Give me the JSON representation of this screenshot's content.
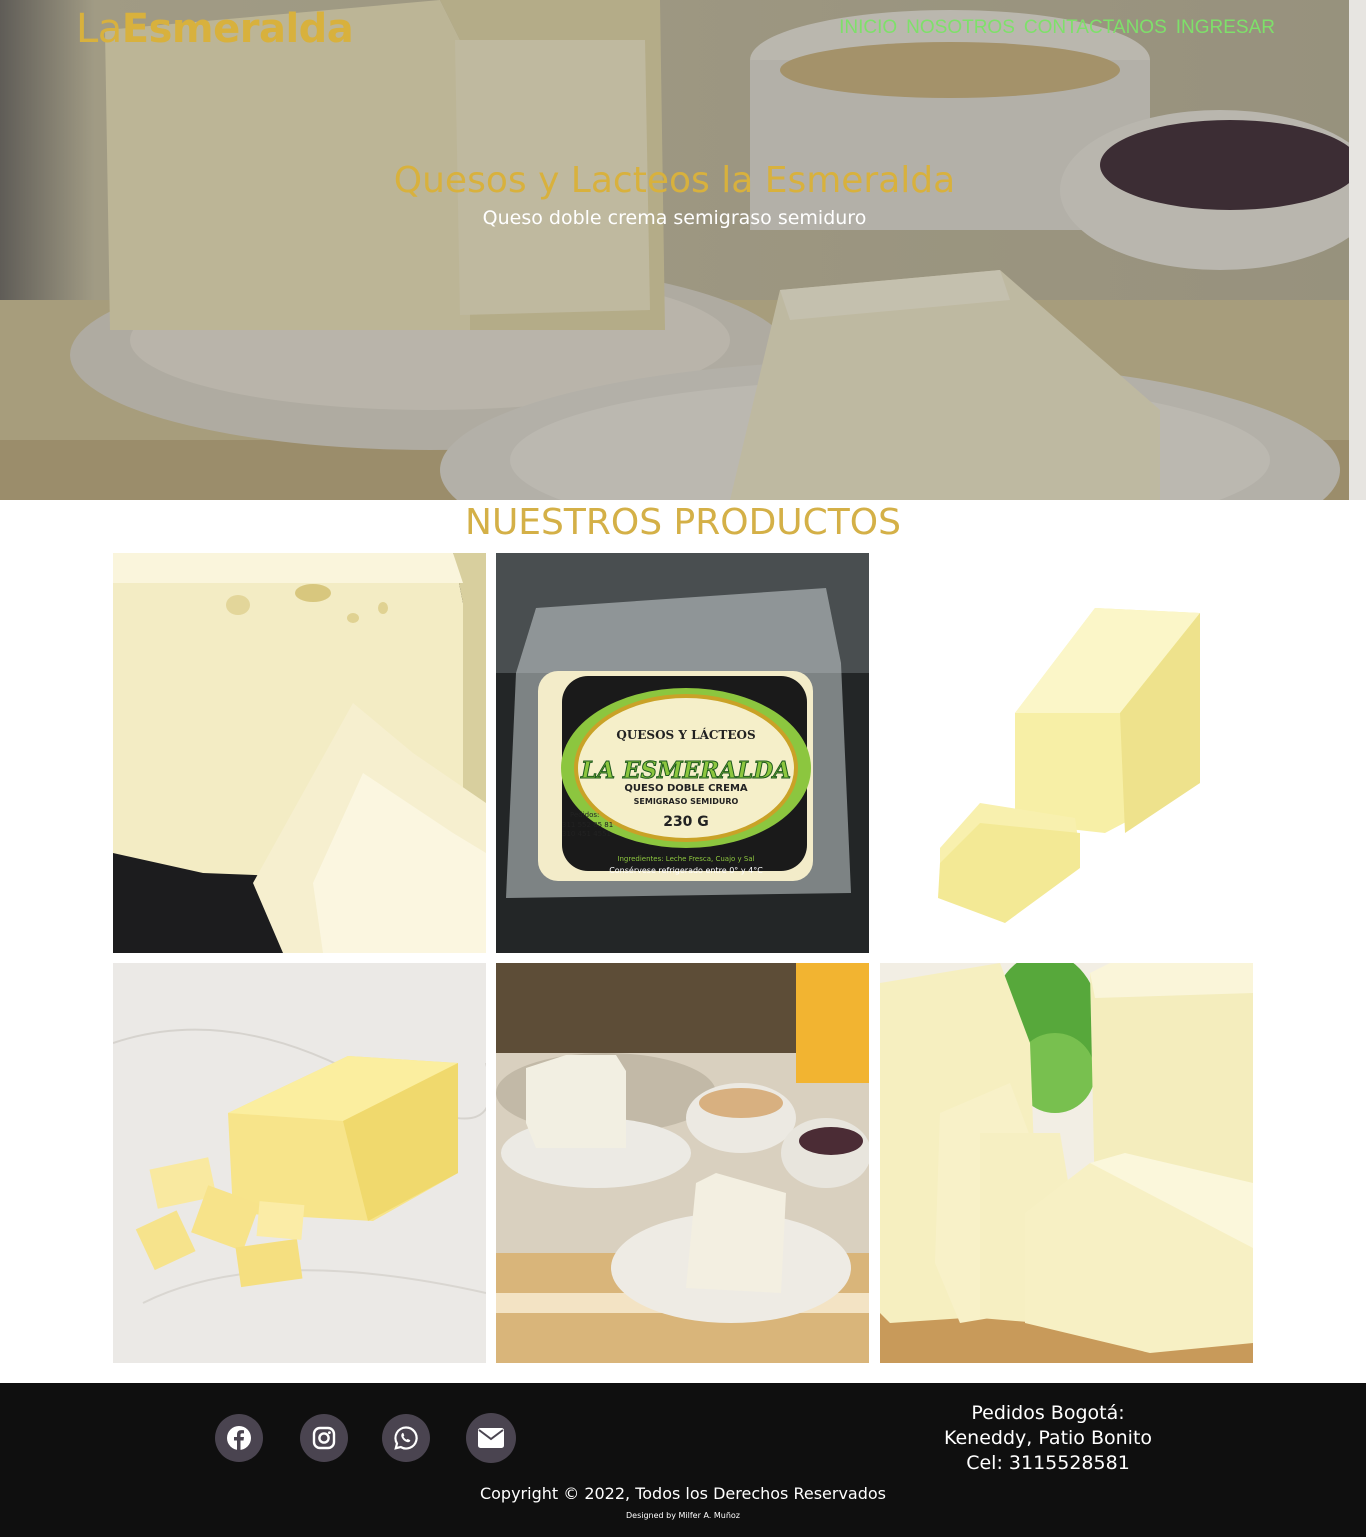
{
  "header": {
    "logo_light": "La",
    "logo_bold": "Esmeralda",
    "nav": [
      "INICIO",
      "NOSOTROS",
      "CONTACTANOS",
      "INGRESAR"
    ]
  },
  "hero": {
    "title": "Quesos y Lacteos la Esmeralda",
    "subtitle": "Queso doble crema semigraso semiduro"
  },
  "products": {
    "title": "NUESTROS PRODUCTOS",
    "package": {
      "brand_top": "QUESOS Y LÁCTEOS",
      "brand": "LA ESMERALDA",
      "product": "QUESO DOBLE CREMA",
      "type": "SEMIGRASO SEMIDURO",
      "weight": "230 G",
      "orders_label": "Pedidos:",
      "phone1": "311 552 85 81",
      "phone2": "310 451 4551",
      "ingredients": "Ingredientes: Leche Fresca, Cuajo y Sal",
      "storage": "Consérvese refrigerado entre 0° y 4°C"
    }
  },
  "footer": {
    "social_icons": [
      "facebook-icon",
      "instagram-icon",
      "whatsapp-icon",
      "envelope-icon"
    ],
    "contact_line1": "Pedidos Bogotá:",
    "contact_line2": "Keneddy, Patio Bonito",
    "contact_line3": "Cel: 3115528581",
    "copyright": "Copyright © 2022, Todos los Derechos Reservados",
    "designed_by": "Designed by Milfer A. Muñoz"
  },
  "colors": {
    "accent_gold": "#d8b13d",
    "nav_green": "#7ee06a",
    "footer_bg": "#0f0f0f",
    "social_bg": "#4a4450",
    "label_green": "#8cc63f"
  }
}
